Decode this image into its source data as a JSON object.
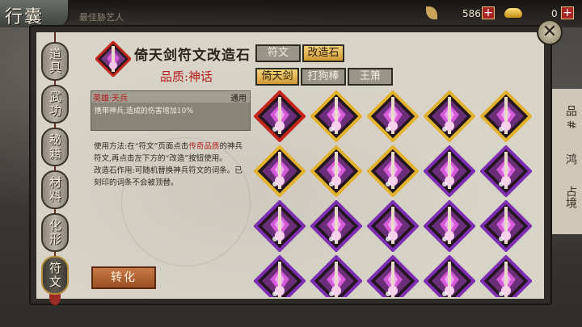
{
  "header": {
    "title": "行囊",
    "faint_text": "最佳胁艺人",
    "currency_1": "586",
    "currency_2": "0"
  },
  "side_tabs": [
    {
      "label": "道具",
      "active": false
    },
    {
      "label": "武功",
      "active": false
    },
    {
      "label": "秘籍",
      "active": false
    },
    {
      "label": "材料",
      "active": false
    },
    {
      "label": "化形",
      "active": false
    },
    {
      "label": "符文",
      "active": true
    }
  ],
  "item": {
    "name": "倚天剑符文改造石",
    "quality": "品质:神话",
    "effect_title": "英雄·天兵",
    "effect_scope": "通用",
    "effect_desc": "携带神兵,造成的伤害增加10%",
    "usage_1": "使用方法:在“符文”页面点击",
    "usage_hl": "传奇品质",
    "usage_2": "的神兵符文,再点击左下方的“改造”按钮使用。",
    "usage_3": "改造石作用:可随机替换神兵符文的词条。已刻印的词条不会被顶替。",
    "convert_label": "转化"
  },
  "tabs_row1": [
    {
      "label": "符文",
      "active": false
    },
    {
      "label": "改造石",
      "active": true
    }
  ],
  "tabs_row2": [
    {
      "label": "倚天剑",
      "active": true
    },
    {
      "label": "打狗棒",
      "active": false
    },
    {
      "label": "王箫",
      "active": false
    }
  ],
  "grid": {
    "rows": 4,
    "cols": 5,
    "border_colors": [
      [
        "red",
        "gold",
        "gold",
        "gold",
        "gold"
      ],
      [
        "gold",
        "gold",
        "gold",
        "purple",
        "purple"
      ],
      [
        "purple",
        "purple",
        "purple",
        "purple",
        "purple"
      ],
      [
        "purple",
        "purple",
        "purple",
        "purple",
        "purple"
      ]
    ]
  },
  "colors": {
    "red": "#c4261c",
    "gold": "#e2b22f",
    "purple": "#7d2fb2",
    "quality_red": "#b51d1d"
  },
  "icons": [
    "close-icon",
    "plus-icon",
    "ingot-icon",
    "leaf-icon",
    "rune-stone-icon"
  ],
  "bg_labels": [
    "品 #",
    "鸿",
    "占境"
  ]
}
